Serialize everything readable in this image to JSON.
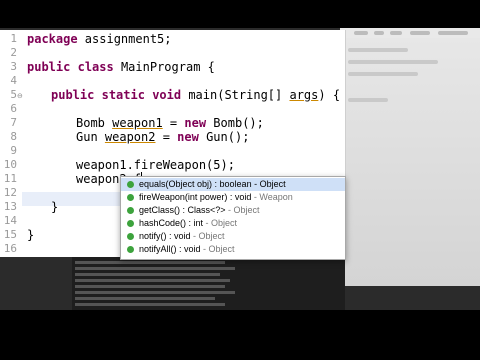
{
  "editor": {
    "lines": [
      {
        "num": "1"
      },
      {
        "num": "2"
      },
      {
        "num": "3"
      },
      {
        "num": "4"
      },
      {
        "num": "5"
      },
      {
        "num": "6"
      },
      {
        "num": "7"
      },
      {
        "num": "8"
      },
      {
        "num": "9"
      },
      {
        "num": "10"
      },
      {
        "num": "11"
      },
      {
        "num": "12"
      },
      {
        "num": "13"
      },
      {
        "num": "14"
      },
      {
        "num": "15"
      },
      {
        "num": "16"
      }
    ],
    "code": {
      "l1_kw": "package",
      "l1_rest": " assignment5;",
      "l3_kw1": "public",
      "l3_kw2": "class",
      "l3_rest": " MainProgram {",
      "l5_kw1": "public",
      "l5_kw2": "static",
      "l5_kw3": "void",
      "l5_rest": " main(String[] ",
      "l5_args": "args",
      "l5_end": ") {",
      "l7_type": "Bomb ",
      "l7_var": "weapon1",
      "l7_eq": " = ",
      "l7_kw": "new",
      "l7_rest": " Bomb();",
      "l8_type": "Gun ",
      "l8_var": "weapon2",
      "l8_eq": " = ",
      "l8_kw": "new",
      "l8_rest": " Gun();",
      "l10": "weapon1.fireWeapon(5);",
      "l11": "weapon2.f",
      "l13": "}",
      "l15": "}"
    }
  },
  "autocomplete": {
    "items": [
      {
        "main": "equals(Object obj) : boolean",
        "sep": " - ",
        "owner": "Object"
      },
      {
        "main": "fireWeapon(int power) : void",
        "sep": " - ",
        "owner": "Weapon"
      },
      {
        "main": "getClass() : Class<?>",
        "sep": " - ",
        "owner": "Object"
      },
      {
        "main": "hashCode() : int",
        "sep": " - ",
        "owner": "Object"
      },
      {
        "main": "notify() : void",
        "sep": " - ",
        "owner": "Object"
      },
      {
        "main": "notifyAll() : void",
        "sep": " - ",
        "owner": "Object"
      }
    ]
  },
  "colors": {
    "keyword": "#7f0055",
    "selection": "#cfe0f7",
    "method_dot": "#3da33d"
  }
}
